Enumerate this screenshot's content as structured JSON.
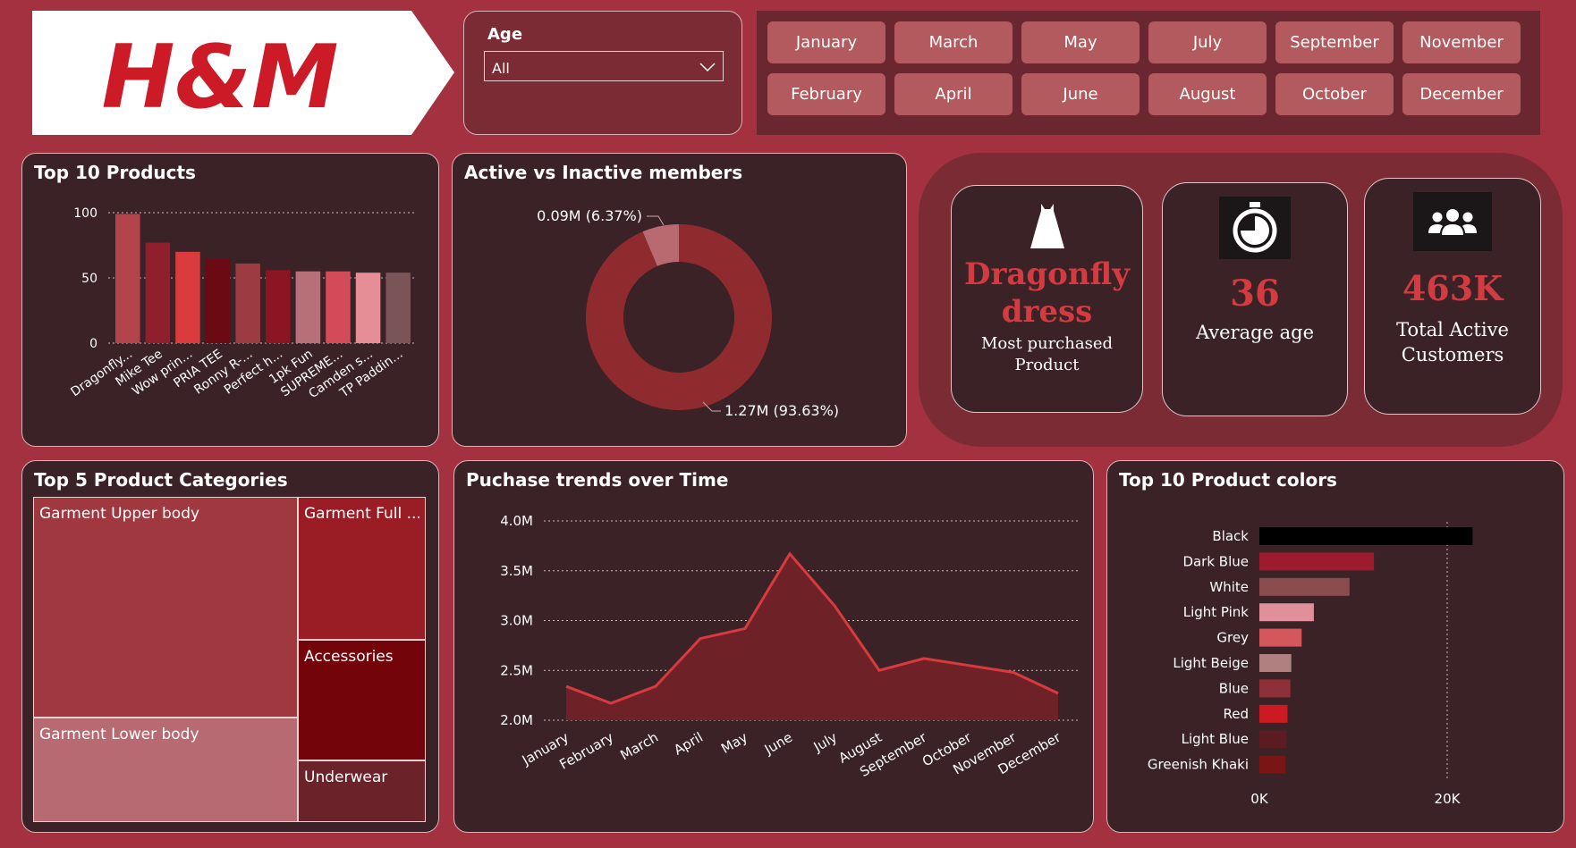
{
  "logo": {
    "text": "H&M"
  },
  "age_filter": {
    "label": "Age",
    "selected": "All"
  },
  "months": [
    "January",
    "March",
    "May",
    "July",
    "September",
    "November",
    "February",
    "April",
    "June",
    "August",
    "October",
    "December"
  ],
  "top_products": {
    "title": "Top 10 Products",
    "chart_data": {
      "type": "bar",
      "categories": [
        "Dragonfly...",
        "Mike Tee",
        "Wow prin...",
        "PRIA TEE",
        "Ronny R-...",
        "Perfect h...",
        "1pk Fun",
        "SUPREME...",
        "Camden s...",
        "TP Paddin..."
      ],
      "values": [
        99,
        77,
        70,
        65,
        61,
        56,
        55,
        55,
        54,
        54
      ],
      "ylim": [
        0,
        100
      ],
      "yticks": [
        "0",
        "50",
        "100"
      ],
      "colors": [
        "#b4444c",
        "#8f1f2b",
        "#dc3b3d",
        "#6b0a12",
        "#9c3b40",
        "#8c1522",
        "#b87078",
        "#d34a58",
        "#e58e95",
        "#7a5457"
      ]
    }
  },
  "members": {
    "title": "Active vs Inactive members",
    "chart_data": {
      "type": "pie",
      "slices": [
        {
          "label": "1.27M (93.63%)",
          "value": 93.63,
          "color": "#8f2a2e"
        },
        {
          "label": "0.09M (6.37%)",
          "value": 6.37,
          "color": "#b86a70"
        }
      ]
    }
  },
  "kpis": {
    "product": {
      "value": "Dragonfly dress",
      "line1": "Dragonfly",
      "line2": "dress",
      "label1": "Most purchased",
      "label2": "Product",
      "icon": "dress-icon"
    },
    "age": {
      "value": "36",
      "label": "Average age",
      "icon": "stopwatch-icon"
    },
    "customers": {
      "value": "463K",
      "label1": "Total Active",
      "label2": "Customers",
      "icon": "people-icon"
    }
  },
  "categories": {
    "title": "Top 5 Product Categories",
    "chart_data": {
      "type": "treemap",
      "items": [
        {
          "label": "Garment Upper body",
          "color": "#a0393f"
        },
        {
          "label": "Garment Lower body",
          "color": "#b86a72"
        },
        {
          "label": "Garment Full ...",
          "color": "#9a1c25"
        },
        {
          "label": "Accessories",
          "color": "#72040a"
        },
        {
          "label": "Underwear",
          "color": "#6b2228"
        }
      ]
    }
  },
  "trends": {
    "title": "Puchase trends over Time",
    "chart_data": {
      "type": "area",
      "x": [
        "January",
        "February",
        "March",
        "April",
        "May",
        "June",
        "July",
        "August",
        "September",
        "October",
        "November",
        "December"
      ],
      "values": [
        2.34,
        2.17,
        2.34,
        2.82,
        2.92,
        3.67,
        3.15,
        2.5,
        2.62,
        2.55,
        2.48,
        2.27
      ],
      "ylim": [
        2.0,
        4.0
      ],
      "yticks": [
        "2.0M",
        "2.5M",
        "3.0M",
        "3.5M",
        "4.0M"
      ]
    }
  },
  "colors_chart": {
    "title": "Top 10 Product colors",
    "chart_data": {
      "type": "bar",
      "orientation": "horizontal",
      "categories": [
        "Black",
        "Dark Blue",
        "White",
        "Light Pink",
        "Grey",
        "Light Beige",
        "Blue",
        "Red",
        "Light Blue",
        "Greenish Khaki"
      ],
      "values": [
        22700,
        12200,
        9600,
        5800,
        4500,
        3400,
        3300,
        3000,
        2900,
        2800
      ],
      "xlim": [
        0,
        25000
      ],
      "xticks": [
        "0K",
        "20K"
      ],
      "colors": [
        "#000000",
        "#9c1b2e",
        "#8a4c4e",
        "#e0909a",
        "#d4585b",
        "#b08080",
        "#8f3038",
        "#cc1b20",
        "#5a1c20",
        "#7a1515"
      ]
    }
  }
}
